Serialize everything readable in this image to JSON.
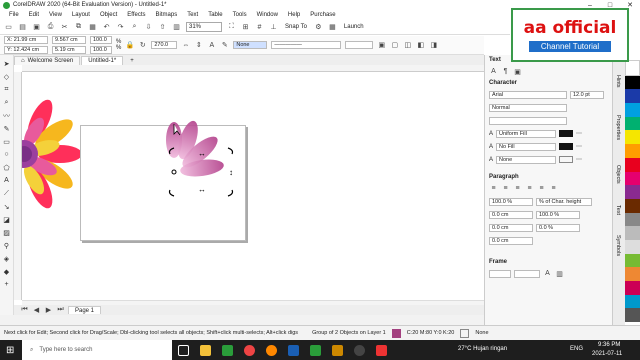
{
  "window": {
    "title": "CorelDRAW 2020 (64-Bit Evaluation Version) - Untitled-1*",
    "min": "–",
    "max": "□",
    "close": "✕"
  },
  "menu": [
    "File",
    "Edit",
    "View",
    "Layout",
    "Object",
    "Effects",
    "Bitmaps",
    "Text",
    "Table",
    "Tools",
    "Window",
    "Help",
    "Purchase"
  ],
  "toolbar": {
    "zoom": "31%",
    "snap": "Snap To",
    "launch": "Launch"
  },
  "propbar": {
    "x": "X: 21.99 cm",
    "y": "Y: 12.424 cm",
    "w": "9.567 cm",
    "h": "5.19 cm",
    "sx": "100.0",
    "sy": "100.0",
    "pct": "%",
    "angle": "270.0",
    "outline": "None"
  },
  "doc_tabs": [
    {
      "label": "Welcome Screen"
    },
    {
      "label": "Untitled-1*"
    }
  ],
  "page_tab": "Page 1",
  "panel": {
    "title": "Text",
    "character": {
      "heading": "Character",
      "font": "Arial",
      "size": "12.0 pt",
      "style": "Normal",
      "fill1": "Uniform Fill",
      "fill2": "No Fill",
      "outline": "None"
    },
    "paragraph": {
      "heading": "Paragraph",
      "spacing": "100.0 %",
      "spacing_unit": "% of Char. height",
      "indent1": "0.0 cm",
      "indent2": "100.0 %",
      "indent3": "0.0 cm",
      "indent4": "0.0 %",
      "indent5": "0.0 cm"
    },
    "frame": {
      "heading": "Frame"
    }
  },
  "dock_tabs": [
    "Hints",
    "Properties",
    "Objects",
    "Text",
    "Symbols"
  ],
  "status": {
    "hint": "Next click for Edit; Second click for Drag/Scale; Dbl-clicking tool selects all objects; Shift+click multi-selects; Alt+click digs",
    "selection": "Group of 2 Objects on Layer 1",
    "color": "C:20 M:80 Y:0 K:20",
    "outline": "None"
  },
  "taskbar": {
    "search": "Type here to search",
    "weather": "27°C Hujan ringan",
    "lang": "ENG",
    "time": "9:36 PM",
    "date": "2021-07-11"
  },
  "watermark": {
    "title": "aa official",
    "subtitle": "Channel Tutorial"
  },
  "colors": {
    "accent": "#3a9a4a",
    "petal": "#c0509a"
  }
}
